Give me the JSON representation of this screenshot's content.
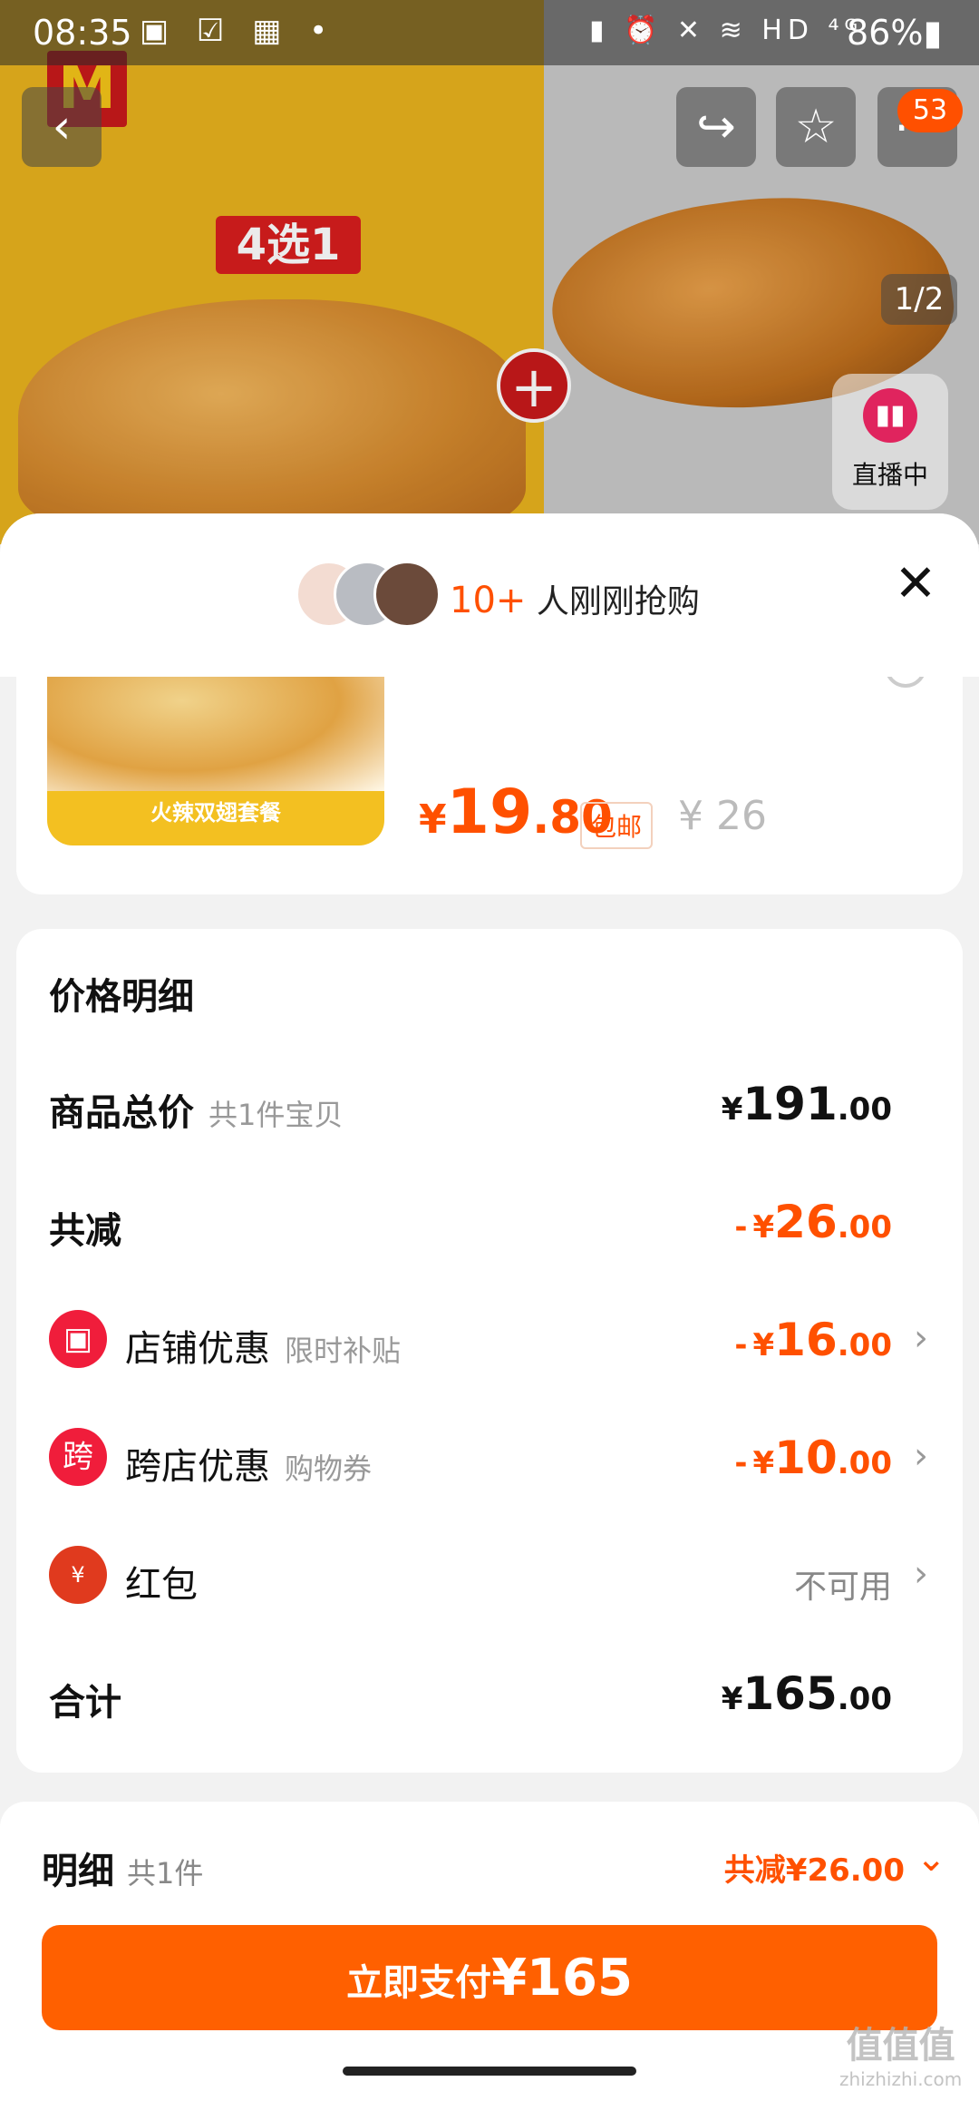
{
  "status_bar": {
    "time": "08:35",
    "left_icons": "▣ ☑ ▦ •",
    "right_icons": "▮ ⏰ ✕ ≋ HD ⁴ᴳ",
    "battery": "86%▮"
  },
  "hero": {
    "brand_logo": "M",
    "promo_tag": "4选1",
    "plus": "+",
    "page_indicator": "1/2",
    "cart_badge": "53",
    "live_label": "直播中"
  },
  "sheet_header": {
    "buyers_count": "10+",
    "buyers_text": "人刚刚抢购"
  },
  "product": {
    "image_caption": "火辣双翅套餐",
    "price_symbol": "¥",
    "price_int": "19",
    "price_dec": ".80",
    "free_shipping": "包邮",
    "original_price": "¥ 26"
  },
  "price_detail": {
    "title": "价格明细",
    "rows": [
      {
        "label": "商品总价",
        "sub": "共1件宝贝",
        "minus": "",
        "symbol": "¥",
        "int": "191",
        "dec": ".00"
      },
      {
        "label": "共减",
        "sub": "",
        "minus": "-",
        "symbol": "¥",
        "int": "26",
        "dec": ".00"
      },
      {
        "label": "店铺优惠",
        "sub": "限时补贴",
        "minus": "-",
        "symbol": "¥",
        "int": "16",
        "dec": ".00",
        "icon_glyph": "▣"
      },
      {
        "label": "跨店优惠",
        "sub": "购物券",
        "minus": "-",
        "symbol": "¥",
        "int": "10",
        "dec": ".00",
        "icon_glyph": "跨"
      },
      {
        "label": "红包",
        "unavailable": "不可用",
        "icon_glyph": "¥"
      },
      {
        "label": "合计",
        "sub": "",
        "minus": "",
        "symbol": "¥",
        "int": "165",
        "dec": ".00"
      }
    ]
  },
  "bottom_bar": {
    "label": "明细",
    "count": "共1件",
    "discount": "共减¥26.00",
    "pay_label": "立即支付",
    "pay_amount": "¥165"
  },
  "watermark": {
    "logo": "值值值",
    "site": "zhizhizhi.com"
  },
  "colors": {
    "accent": "#ff5000",
    "pay_button": "#ff6000",
    "coupon_icon": "#f01d3b"
  },
  "icons": [
    "back-icon",
    "share-icon",
    "star-icon",
    "more-icon",
    "live-icon",
    "close-icon",
    "shop-icon",
    "cross-store-icon",
    "red-packet-icon",
    "chevron-right-icon",
    "chevron-down-icon"
  ]
}
